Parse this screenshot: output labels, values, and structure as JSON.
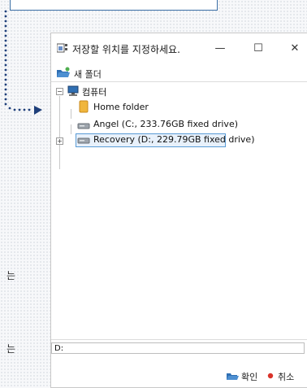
{
  "dialog": {
    "title": "저장할 위치를 지정하세요.",
    "minimize_glyph": "—",
    "maximize_glyph": "☐",
    "close_glyph": "✕",
    "new_folder_label": "새 폴더",
    "tree": {
      "root": {
        "label": "컴퓨터",
        "expander": "−"
      },
      "items": [
        {
          "label": "Home folder"
        },
        {
          "label": "Angel (C:, 233.76GB fixed drive)"
        },
        {
          "label": "Recovery (D:, 229.79GB fixed drive)",
          "expander": "+",
          "selected": true
        }
      ]
    },
    "path_value": "D:",
    "ok_label": "확인",
    "cancel_label": "취소"
  },
  "background": {
    "side_text_1": "는",
    "side_text_2": "는"
  },
  "colors": {
    "accent": "#1f4e8c",
    "selection": "#e8f1fb",
    "folder_yellow": "#f0b63c",
    "cancel_red": "#d9332a"
  }
}
